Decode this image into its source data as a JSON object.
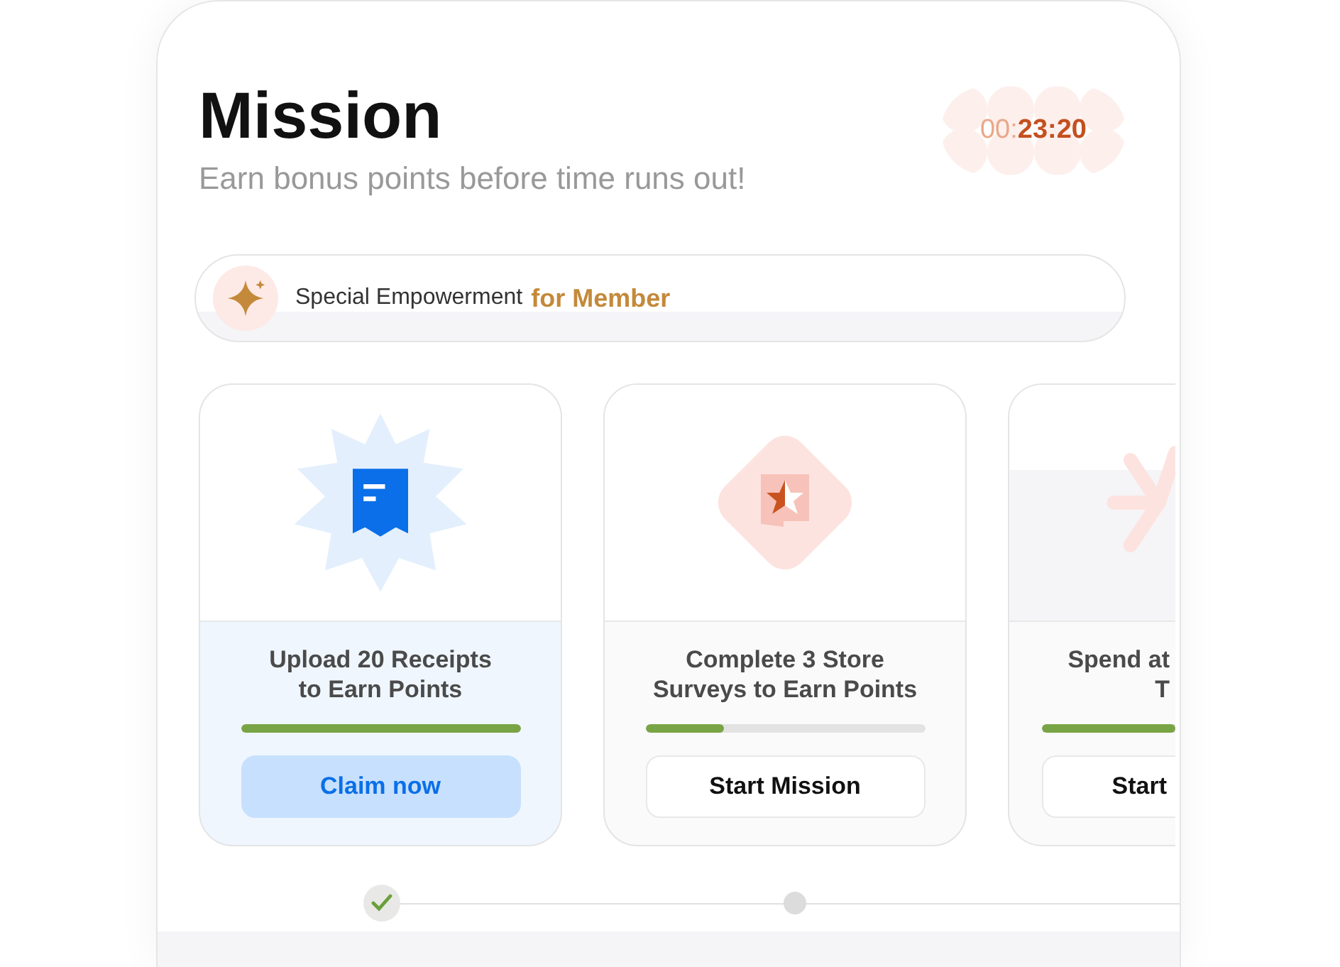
{
  "header": {
    "title": "Mission",
    "subtitle": "Earn bonus points before time runs out!"
  },
  "timer": {
    "dim": "00:",
    "bold": "23:20"
  },
  "banner": {
    "label": "Special Empowerment",
    "highlight": "for Member"
  },
  "missions": [
    {
      "kind": "full",
      "title_lines": [
        "Upload 20 Receipts",
        "to Earn Points"
      ],
      "level": 1,
      "button": {
        "kind": "claim",
        "label": "Claim now"
      }
    },
    {
      "kind": "full",
      "title_lines": [
        "Complete 3 Store",
        "Surveys to Earn Points"
      ],
      "level": 0.28,
      "button": {
        "kind": "start",
        "label": "Start Mission"
      }
    },
    {
      "kind": "partial",
      "title_lines": [
        "Spend at",
        "T"
      ],
      "level": 1,
      "button": {
        "kind": "start",
        "label": "Start"
      }
    }
  ],
  "pager": [
    {
      "done": true
    },
    {
      "done": false
    }
  ]
}
